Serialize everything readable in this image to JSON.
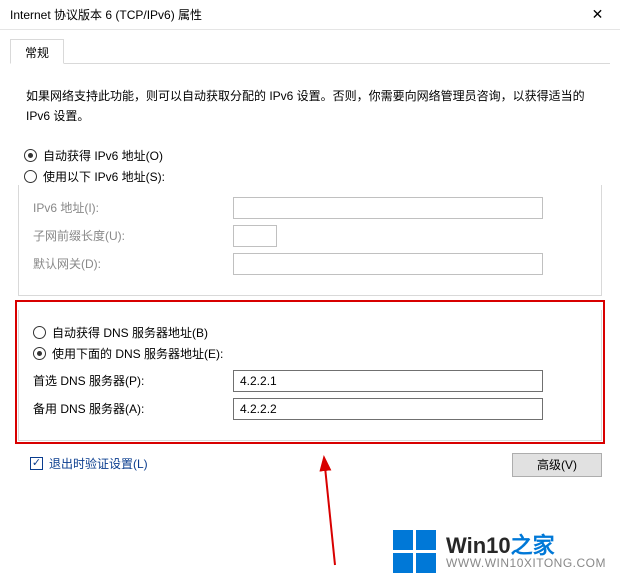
{
  "window": {
    "title": "Internet 协议版本 6 (TCP/IPv6) 属性"
  },
  "tabs": {
    "general": "常规"
  },
  "intro": "如果网络支持此功能，则可以自动获取分配的 IPv6 设置。否则，你需要向网络管理员咨询，以获得适当的 IPv6 设置。",
  "ip": {
    "auto_label": "自动获得 IPv6 地址(O)",
    "manual_label": "使用以下 IPv6 地址(S):",
    "addr_label": "IPv6 地址(I):",
    "addr_value": "",
    "prefix_label": "子网前缀长度(U):",
    "prefix_value": "",
    "gw_label": "默认网关(D):",
    "gw_value": ""
  },
  "dns": {
    "auto_label": "自动获得 DNS 服务器地址(B)",
    "manual_label": "使用下面的 DNS 服务器地址(E):",
    "pref_label": "首选 DNS 服务器(P):",
    "pref_value": "4.2.2.1",
    "alt_label": "备用 DNS 服务器(A):",
    "alt_value": "4.2.2.2"
  },
  "footer": {
    "validate_label": "退出时验证设置(L)",
    "advanced_label": "高级(V)"
  },
  "watermark": {
    "brand_a": "Win10",
    "brand_b": "之家",
    "url": "WWW.WIN10XITONG.COM"
  }
}
